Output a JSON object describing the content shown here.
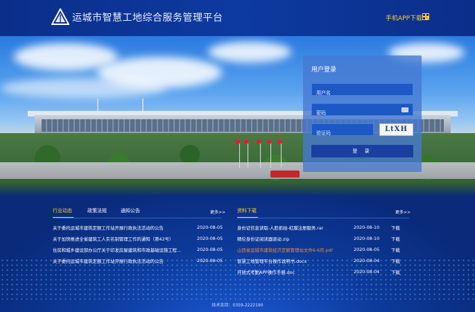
{
  "header": {
    "title": "运城市智慧工地综合服务管理平台",
    "app_download": "手机APP下载",
    "accent_color": "#f4d13a",
    "logo_icon": "triangle-logo-icon",
    "qr_icon": "qr-code-icon"
  },
  "login": {
    "title": "用户登录",
    "username_placeholder": "用户名",
    "password_placeholder": "密码",
    "captcha_placeholder": "验证码",
    "captcha_text": "LtXH",
    "submit_label": "登 录"
  },
  "news": {
    "tabs": [
      {
        "label": "行业动态",
        "active": true
      },
      {
        "label": "政策法规",
        "active": false
      },
      {
        "label": "通知公告",
        "active": false
      }
    ],
    "more_label": "更多>>",
    "items": [
      {
        "title": "关于委托运城市建筑定额工作站开展行政执法活动的公告",
        "date": "2020-08-05"
      },
      {
        "title": "关于加快推进全省建筑工人实名制管理工作的通知（第42号）",
        "date": "2020-08-05"
      },
      {
        "title": "住房和城乡建设部办公厅关于印发房屋建筑和市政基础设施工程...",
        "date": "2020-08-05"
      },
      {
        "title": "关于委托运城市建筑定额工作站开展行政执法活动的公告",
        "date": "2020-08-05"
      }
    ]
  },
  "downloads": {
    "title": "资料下载",
    "more_label": "更多>>",
    "action_label": "下载",
    "items": [
      {
        "title": "身份证信息读取-人脸抓拍-虹膜注册服务.rar",
        "date": "2020-08-10",
        "highlight": false
      },
      {
        "title": "精伦身份证阅读器驱动.zip",
        "date": "2020-08-10",
        "highlight": false
      },
      {
        "title": "山西省运城市建筑经济定额管理站文件6-6月.pdf",
        "date": "2020-08-05",
        "highlight": true
      },
      {
        "title": "智慧工地管理平台操作说明书.docx",
        "date": "2020-08-04",
        "highlight": false
      },
      {
        "title": "开放式考勤APP操作手册.doc",
        "date": "2020-08-04",
        "highlight": false
      }
    ]
  },
  "footer": {
    "support": "技术支持：0359-2222190"
  }
}
